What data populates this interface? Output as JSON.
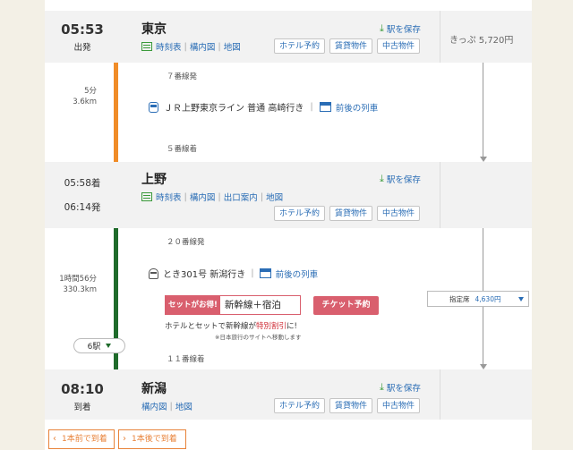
{
  "stations": {
    "tokyo": {
      "time": "05:53",
      "label": "出発",
      "name": "東京",
      "links": [
        "時刻表",
        "構内図",
        "地図"
      ],
      "save": "駅を保存"
    },
    "ueno": {
      "arr_time": "05:58着",
      "dep_time": "06:14発",
      "name": "上野",
      "links": [
        "時刻表",
        "構内図",
        "出口案内",
        "地図"
      ],
      "save": "駅を保存"
    },
    "niigata": {
      "time": "08:10",
      "label": "到着",
      "name": "新潟",
      "links": [
        "構内図",
        "地図"
      ],
      "save": "駅を保存"
    }
  },
  "services": [
    "ホテル予約",
    "賃貸物件",
    "中古物件"
  ],
  "fare": "きっぷ 5,720円",
  "legs": [
    {
      "duration": "5分",
      "distance": "3.6km",
      "dep_platform": "７番線発",
      "train": "ＪＲ上野東京ライン 普通 高崎行き",
      "timetable_link": "前後の列車",
      "arr_platform": "５番線着",
      "color": "#f08c28"
    },
    {
      "duration": "1時間56分",
      "distance": "330.3km",
      "dep_platform": "２０番線発",
      "train": "とき301号 新潟行き",
      "timetable_link": "前後の列車",
      "arr_platform": "１１番線着",
      "stops": "6駅",
      "color": "#1f6b2b",
      "seat_class": "指定席",
      "seat_price": "4,630円"
    }
  ],
  "promo": {
    "badge": "セットがお得!",
    "title": "新幹線＋宿泊",
    "ticket_button": "チケット予約",
    "line1_a": "ホテルとセットで新幹線が",
    "line1_b": "特別割引",
    "line1_c": "に!",
    "note": "※日本旅行のサイトへ移動します"
  },
  "nav": {
    "earlier": "1本前で到着",
    "later": "1本後で到着"
  },
  "colors": {
    "link": "#2a6db5",
    "accent_orange": "#e8833a",
    "promo_red": "#d95f6e",
    "green": "#3a9a3a"
  }
}
